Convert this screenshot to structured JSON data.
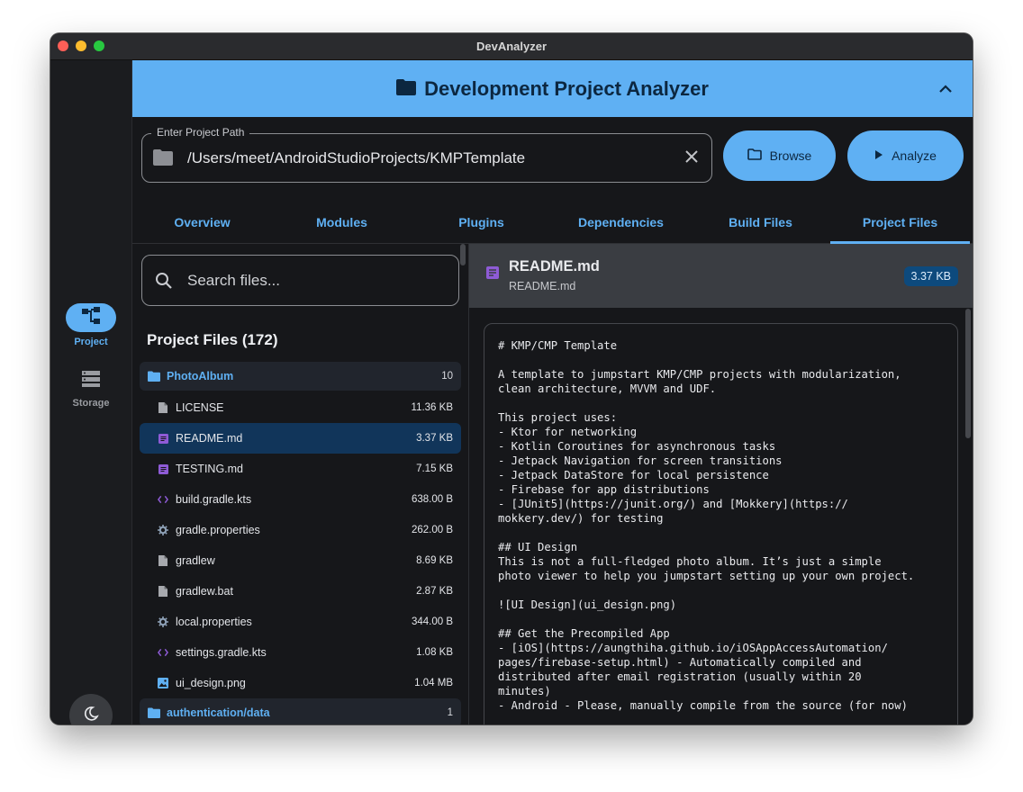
{
  "window": {
    "title": "DevAnalyzer"
  },
  "sidebar": {
    "items": [
      {
        "label": "Project",
        "icon": "project-tree-icon",
        "active": true
      },
      {
        "label": "Storage",
        "icon": "storage-icon",
        "active": false
      }
    ],
    "theme_toggle_icon": "moon-icon"
  },
  "header": {
    "title": "Development Project Analyzer",
    "icon": "folder-icon"
  },
  "path": {
    "label": "Enter Project Path",
    "value": "/Users/meet/AndroidStudioProjects/KMPTemplate"
  },
  "buttons": {
    "browse": "Browse",
    "analyze": "Analyze"
  },
  "tabs": [
    "Overview",
    "Modules",
    "Plugins",
    "Dependencies",
    "Build Files",
    "Project Files"
  ],
  "active_tab": "Project Files",
  "search": {
    "placeholder": "Search files..."
  },
  "files": {
    "heading": "Project Files (172)",
    "rows": [
      {
        "type": "folder",
        "name": "PhotoAlbum",
        "size": "10",
        "icon": "folder-icon"
      },
      {
        "type": "file",
        "name": "LICENSE",
        "size": "11.36 KB",
        "icon": "file-icon"
      },
      {
        "type": "file",
        "name": "README.md",
        "size": "3.37 KB",
        "icon": "markdown-icon",
        "selected": true
      },
      {
        "type": "file",
        "name": "TESTING.md",
        "size": "7.15 KB",
        "icon": "markdown-icon"
      },
      {
        "type": "file",
        "name": "build.gradle.kts",
        "size": "638.00 B",
        "icon": "code-icon"
      },
      {
        "type": "file",
        "name": "gradle.properties",
        "size": "262.00 B",
        "icon": "gear-icon"
      },
      {
        "type": "file",
        "name": "gradlew",
        "size": "8.69 KB",
        "icon": "file-icon"
      },
      {
        "type": "file",
        "name": "gradlew.bat",
        "size": "2.87 KB",
        "icon": "file-icon"
      },
      {
        "type": "file",
        "name": "local.properties",
        "size": "344.00 B",
        "icon": "gear-icon"
      },
      {
        "type": "file",
        "name": "settings.gradle.kts",
        "size": "1.08 KB",
        "icon": "code-icon"
      },
      {
        "type": "file",
        "name": "ui_design.png",
        "size": "1.04 MB",
        "icon": "image-icon"
      },
      {
        "type": "folder",
        "name": "authentication/data",
        "size": "1",
        "icon": "folder-icon"
      }
    ]
  },
  "preview": {
    "title": "README.md",
    "subtitle": "README.md",
    "size": "3.37 KB",
    "content": "# KMP/CMP Template\n\nA template to jumpstart KMP/CMP projects with modularization,\nclean architecture, MVVM and UDF.\n\nThis project uses:\n- Ktor for networking\n- Kotlin Coroutines for asynchronous tasks\n- Jetpack Navigation for screen transitions\n- Jetpack DataStore for local persistence\n- Firebase for app distributions\n- [JUnit5](https://junit.org/) and [Mokkery](https://\nmokkery.dev/) for testing\n\n## UI Design\nThis is not a full-fledged photo album. It’s just a simple\nphoto viewer to help you jumpstart setting up your own project.\n\n![UI Design](ui_design.png)\n\n## Get the Precompiled App\n- [iOS](https://aungthiha.github.io/iOSAppAccessAutomation/\npages/firebase-setup.html) - Automatically compiled and\ndistributed after email registration (usually within 20\nminutes)\n- Android - Please, manually compile from the source (for now)\n\n## Set up the Project"
  },
  "colors": {
    "accent": "#5fb0f3",
    "header_text": "#0c2740",
    "background": "#16171a",
    "selected_row": "#11355a",
    "folder_row": "#21252d",
    "markdown_icon": "#8e5bd6",
    "badge_bg": "#0d4a7d"
  }
}
